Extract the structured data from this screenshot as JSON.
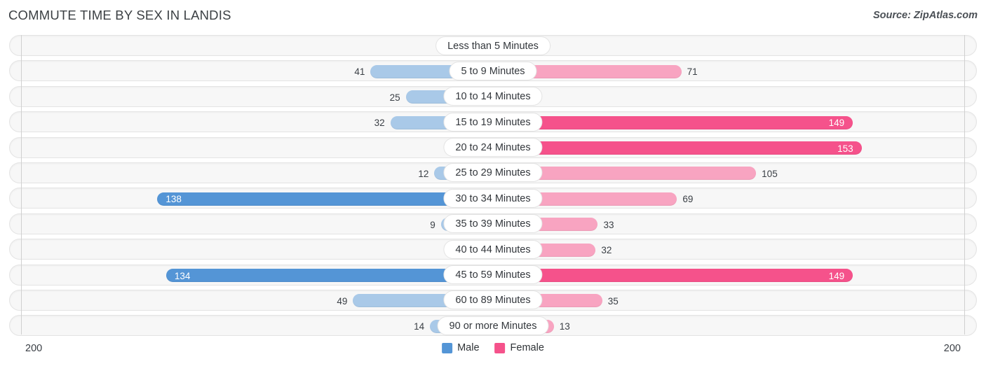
{
  "header": {
    "title": "COMMUTE TIME BY SEX IN LANDIS",
    "source": "Source: ZipAtlas.com"
  },
  "legend": {
    "male_label": "Male",
    "female_label": "Female",
    "male_color": "#5495d6",
    "female_color": "#f5528b"
  },
  "axis": {
    "left_tick": "200",
    "right_tick": "200",
    "max": 200
  },
  "chart_data": {
    "type": "bar",
    "orientation": "horizontal-diverging",
    "title": "COMMUTE TIME BY SEX IN LANDIS",
    "xlabel": "",
    "ylabel": "",
    "xlim": [
      200,
      200
    ],
    "grid": false,
    "legend_position": "bottom-center",
    "categories": [
      "Less than 5 Minutes",
      "5 to 9 Minutes",
      "10 to 14 Minutes",
      "15 to 19 Minutes",
      "20 to 24 Minutes",
      "25 to 29 Minutes",
      "30 to 34 Minutes",
      "35 to 39 Minutes",
      "40 to 44 Minutes",
      "45 to 59 Minutes",
      "60 to 89 Minutes",
      "90 or more Minutes"
    ],
    "series": [
      {
        "name": "Male",
        "values": [
          0,
          41,
          25,
          32,
          0,
          12,
          138,
          9,
          0,
          134,
          49,
          14
        ]
      },
      {
        "name": "Female",
        "values": [
          0,
          71,
          0,
          149,
          153,
          105,
          69,
          33,
          32,
          149,
          35,
          13
        ]
      }
    ]
  },
  "rows": [
    {
      "label": "Less than 5 Minutes",
      "male": "0",
      "female": "0",
      "male_hl": false,
      "female_hl": false
    },
    {
      "label": "5 to 9 Minutes",
      "male": "41",
      "female": "71",
      "male_hl": false,
      "female_hl": false
    },
    {
      "label": "10 to 14 Minutes",
      "male": "25",
      "female": "0",
      "male_hl": false,
      "female_hl": false
    },
    {
      "label": "15 to 19 Minutes",
      "male": "32",
      "female": "149",
      "male_hl": false,
      "female_hl": true
    },
    {
      "label": "20 to 24 Minutes",
      "male": "0",
      "female": "153",
      "male_hl": false,
      "female_hl": true
    },
    {
      "label": "25 to 29 Minutes",
      "male": "12",
      "female": "105",
      "male_hl": false,
      "female_hl": false
    },
    {
      "label": "30 to 34 Minutes",
      "male": "138",
      "female": "69",
      "male_hl": true,
      "female_hl": false
    },
    {
      "label": "35 to 39 Minutes",
      "male": "9",
      "female": "33",
      "male_hl": false,
      "female_hl": false
    },
    {
      "label": "40 to 44 Minutes",
      "male": "0",
      "female": "32",
      "male_hl": false,
      "female_hl": false
    },
    {
      "label": "45 to 59 Minutes",
      "male": "134",
      "female": "149",
      "male_hl": true,
      "female_hl": true
    },
    {
      "label": "60 to 89 Minutes",
      "male": "49",
      "female": "35",
      "male_hl": false,
      "female_hl": false
    },
    {
      "label": "90 or more Minutes",
      "male": "14",
      "female": "13",
      "male_hl": false,
      "female_hl": false
    }
  ]
}
